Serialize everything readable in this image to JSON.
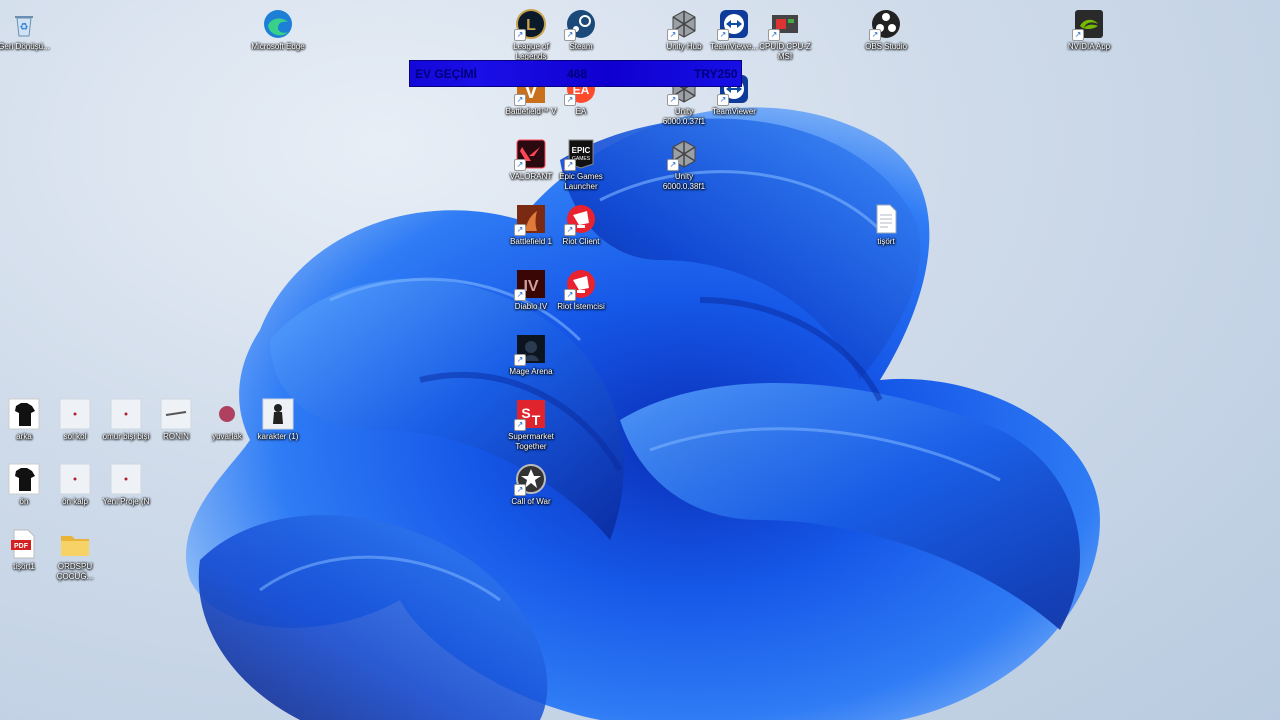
{
  "desktop": {
    "icons": [
      {
        "id": "recycle",
        "label": "Geri Dönüşü...",
        "icon": "recycle-bin-icon",
        "shortcut": false,
        "bg": "#e9f0f7"
      },
      {
        "id": "edge",
        "label": "Microsoft Edge",
        "icon": "edge-icon",
        "shortcut": false,
        "bg": "#1d7fd6"
      },
      {
        "id": "lol",
        "label": "League of Legends",
        "icon": "league-of-legends-icon",
        "shortcut": true,
        "bg": "#0a1a2a"
      },
      {
        "id": "steam",
        "label": "Steam",
        "icon": "steam-icon",
        "shortcut": true,
        "bg": "#1b2838"
      },
      {
        "id": "unityhub",
        "label": "Unity Hub",
        "icon": "unity-hub-icon",
        "shortcut": true,
        "bg": "#222"
      },
      {
        "id": "teamviewer1",
        "label": "TeamViewe...",
        "icon": "teamviewer-icon",
        "shortcut": true,
        "bg": "#0e4da4"
      },
      {
        "id": "cpuid",
        "label": "CPUID CPU-Z MSI",
        "icon": "cpu-z-icon",
        "shortcut": true,
        "bg": "#555"
      },
      {
        "id": "obs",
        "label": "OBS Studio",
        "icon": "obs-icon",
        "shortcut": true,
        "bg": "#222"
      },
      {
        "id": "nvidia",
        "label": "NVIDIA App",
        "icon": "nvidia-icon",
        "shortcut": true,
        "bg": "#2a2a2a"
      },
      {
        "id": "bf5",
        "label": "Battlefield™ V",
        "icon": "battlefield-v-icon",
        "shortcut": true,
        "bg": "#c86a1a"
      },
      {
        "id": "ea",
        "label": "EA",
        "icon": "ea-icon",
        "shortcut": true,
        "bg": "#ff4b2b"
      },
      {
        "id": "unity1",
        "label": "Unity 6000.0.37f1",
        "icon": "unity-icon",
        "shortcut": true,
        "bg": "#555"
      },
      {
        "id": "teamviewer2",
        "label": "TeamViewer",
        "icon": "teamviewer-icon",
        "shortcut": true,
        "bg": "#0e4da4"
      },
      {
        "id": "valorant",
        "label": "VALORANT",
        "icon": "valorant-icon",
        "shortcut": true,
        "bg": "#2a0a10"
      },
      {
        "id": "epic",
        "label": "Epic Games Launcher",
        "icon": "epic-games-icon",
        "shortcut": true,
        "bg": "#111"
      },
      {
        "id": "unity2",
        "label": "Unity 6000.0.38f1",
        "icon": "unity-icon",
        "shortcut": true,
        "bg": "#555"
      },
      {
        "id": "tisort",
        "label": "tişört",
        "icon": "text-file-icon",
        "shortcut": false,
        "bg": "#f4f6fa"
      },
      {
        "id": "bf1",
        "label": "Battlefield 1",
        "icon": "battlefield-1-icon",
        "shortcut": true,
        "bg": "#7a2a12"
      },
      {
        "id": "riot1",
        "label": "Riot Client",
        "icon": "riot-client-icon",
        "shortcut": true,
        "bg": "#e8222f"
      },
      {
        "id": "diablo",
        "label": "Diablo IV",
        "icon": "diablo-iv-icon",
        "shortcut": true,
        "bg": "#5a0a0a"
      },
      {
        "id": "riot2",
        "label": "Riot İstemcisi",
        "icon": "riot-client-icon",
        "shortcut": true,
        "bg": "#e8222f"
      },
      {
        "id": "mage",
        "label": "Mage Arena",
        "icon": "mage-arena-icon",
        "shortcut": true,
        "bg": "#0c1420"
      },
      {
        "id": "supermarket",
        "label": "Supermarket Together",
        "icon": "supermarket-together-icon",
        "shortcut": true,
        "bg": "#e0242e"
      },
      {
        "id": "callofwar",
        "label": "Call of War",
        "icon": "call-of-war-icon",
        "shortcut": true,
        "bg": "#2a2a2a"
      },
      {
        "id": "arka",
        "label": "arka",
        "icon": "tshirt-image-icon",
        "shortcut": false,
        "bg": "#ffffff"
      },
      {
        "id": "sulkol",
        "label": "sol kol",
        "icon": "blank-image-icon",
        "shortcut": false,
        "bg": "#e6ecf3"
      },
      {
        "id": "omur",
        "label": "omur bişi bişi",
        "icon": "blank-image-icon",
        "shortcut": false,
        "bg": "#e6ecf3"
      },
      {
        "id": "ronin",
        "label": "RONIN",
        "icon": "blade-image-icon",
        "shortcut": false,
        "bg": "#e6ecf3"
      },
      {
        "id": "yuvarlak",
        "label": "yuvarlak",
        "icon": "circle-image-icon",
        "shortcut": false,
        "bg": "transparent"
      },
      {
        "id": "karakter",
        "label": "karakter (1)",
        "icon": "character-image-icon",
        "shortcut": false,
        "bg": "#e6ecf3"
      },
      {
        "id": "on",
        "label": "ön",
        "icon": "tshirt-image-icon",
        "shortcut": false,
        "bg": "#ffffff"
      },
      {
        "id": "onkalp",
        "label": "ön kalp",
        "icon": "blank-image-icon",
        "shortcut": false,
        "bg": "#e6ecf3"
      },
      {
        "id": "yeniproje",
        "label": "Yeni Proje (N",
        "icon": "blank-image-icon",
        "shortcut": false,
        "bg": "#e6ecf3"
      },
      {
        "id": "tisort1",
        "label": "tişört1",
        "icon": "pdf-file-icon",
        "shortcut": false,
        "bg": "#ffffff"
      },
      {
        "id": "folder",
        "label": "ORDSPU ÇOCUĞ...",
        "icon": "folder-icon",
        "shortcut": false,
        "bg": "#f3c74a"
      }
    ]
  },
  "overlay": {
    "left": "EV GEÇİMİ",
    "middle": "468",
    "right": "TRY250"
  }
}
